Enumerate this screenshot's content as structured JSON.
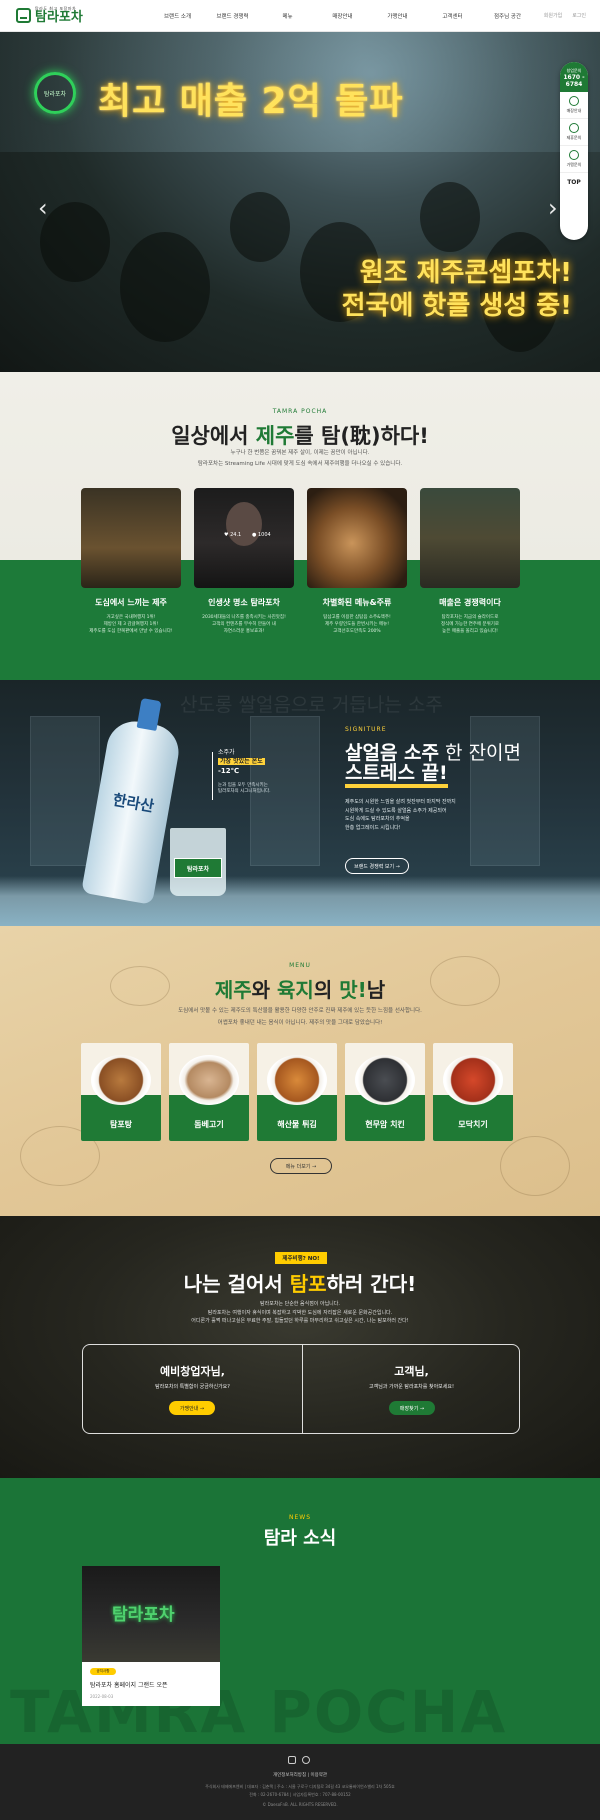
{
  "header": {
    "logo_sub": "탐라도 최고 포장마차",
    "logo_main": "탐라포차",
    "nav": [
      "브랜드 소개",
      "브랜드 경쟁력",
      "메뉴",
      "매장안내",
      "가맹안내",
      "고객센터",
      "점주님 공간"
    ],
    "util": [
      "회원가입",
      "로그인"
    ]
  },
  "hero": {
    "badge": "탐라포차",
    "line1": "최고 매출 2억 돌파",
    "line2a": "원조 제주콘셉포차!",
    "line2b": "전국에 핫플 생성 중!",
    "prev": "‹",
    "next": "›"
  },
  "quick": {
    "phone_label": "창업문의",
    "phone_a": "1670 -",
    "phone_b": "6784",
    "items": [
      "매장안내",
      "제휴문의",
      "가맹문의"
    ],
    "top": "TOP"
  },
  "intro": {
    "eyebrow": "TAMRA POCHA",
    "title_a": "일상에서 ",
    "title_g": "제주",
    "title_b": "를 탐(耽)하다!",
    "desc1": "누구나 한 번쯤은 꿈꿔본 제주 살이, 이제는 꿈만이 아닙니다.",
    "desc2": "탐라포차는 Streaming Life 시대에 맞게 도심 속에서 제주여행을 더나오실 수 있습니다.",
    "cards": [
      {
        "title": "도심에서 느끼는 제주",
        "d1": "거고싶은 국내여행지 1위!",
        "d2": "제방인 제 3 감귤여행지 1위!",
        "d3": "제주도를 도심 한복판에서 만날 수 있습니다!"
      },
      {
        "title": "인생샷 명소 탐라포차",
        "d1": "2030세대들의 나즈를 충족시키는 사진맛집!",
        "d2": "고객의 컨텐츠를 무수히 만들어 내",
        "d3": "자연스러운 홍보효과!"
      },
      {
        "title": "차별화된 메뉴&주류",
        "d1": "탐삼고를 이용한 삼탐음 소주&맥주!",
        "d2": "제주 우량인도들 한번시키는 메뉴!",
        "d3": "고객선호도만족도 200%"
      },
      {
        "title": "매출은 경쟁력이다",
        "d1": "탐라포차는 지금의 슬라이드로",
        "d2": "정식에 가능한 연주에 분위기로",
        "d3": "높은 매출을 올리고 있습니다!"
      }
    ],
    "like_count": "24.1",
    "comment_count": "1004"
  },
  "signature": {
    "bg_text": "산도롱 쌀얼음으로 거듭나는 소주",
    "temp_a": "소주가",
    "temp_hl": "가장 맛있는 온도",
    "temp_deg": "-12℃",
    "temp_s1": "눈과 입을 모두 만족시키는",
    "temp_s2": "탐라포차의 시그니처입니다.",
    "bottle_label": "한라산",
    "glass_label": "탐라포차",
    "eyebrow": "SIGNITURE",
    "t1_a": "살얼음 소주",
    "t1_b": " 한 잔이면",
    "t2": "스트레스 끝!",
    "d1": "제주도의 시원한 느낌을 살려 첫잔부터 마지막 잔까지",
    "d2": "시원하게 드실 수 있도록 살얼음 소주가 제공되어",
    "d3": "도심 속에도 탐라포차의 추억을",
    "d4": "한층 업그레이드 시킵니다!",
    "btn": "브랜드 경쟁력 보기 →"
  },
  "menu": {
    "eyebrow": "MENU",
    "title_a": "제주",
    "title_b": "와 ",
    "title_c": "육지",
    "title_d": "의 ",
    "title_e": "맛!",
    "title_f": "남",
    "desc1": "도심에서 맛볼 수 있는 제주도의 특산물을 활용한 다양한 안주로 진짜 제주에 있는 듯한 느낌을 선사합니다.",
    "desc2": "어썹포차 좋내던 내는 음식이 아닙니다. 제주의 맛을 그대로 담았습니다!",
    "items": [
      "탐포탕",
      "돔베고기",
      "해산물 튀김",
      "현무암 치킨",
      "모닥치기"
    ],
    "btn": "메뉴 더보기 →"
  },
  "startup": {
    "tag": "제주비행? NO!",
    "title_a": "나는 걸어서 ",
    "title_y": "탐포",
    "title_b": "하러 간다!",
    "d1": "탐라포차는 단순한 음식점이 아닙니다.",
    "d2": "탐라포차는 여행이자 휴식이며 복잡하고 각박한 도심에 자리잡은 새로운 문화공간입니다.",
    "d3": "어디론가 훌쩍 떠나고싶은 무료한 주말, 힘들었던 하루를 마무리하고 쉬고싶은 시간, 나는 탐포하러 간다!",
    "left_title": "예비창업자님,",
    "left_desc": "탐라포차의 특별함이 궁금하신가요?",
    "left_btn": "가맹안내 →",
    "right_title": "고객님,",
    "right_desc": "고객님과 가까운 탐라포차를 찾아보세요!",
    "right_btn": "매장찾기 →",
    "accent_yellow": "#ffcc00",
    "accent_green": "#1f7a35"
  },
  "news": {
    "eyebrow": "NEWS",
    "title": "탐라 소식",
    "watermark": "TAMRA POCHA",
    "item": {
      "logo": "탐라포차",
      "tag": "공지사항",
      "title": "탐라포차 홈페이지 그랜드 오픈",
      "date": "2022-08-03"
    }
  },
  "footer": {
    "icons": [
      "facebook-icon",
      "instagram-icon"
    ],
    "links": "개인정보처리방침 | 이용약관",
    "info1": "주식회사 태제에프엔비 | 대표자 : 김춘택 | 주소 : 서울 구로구 디지털로 34길 43 코오롱싸이언스밸리 1차 505호",
    "info2": "전화 : 02-2670-6784 | 사업자등록번호 : 707-88-00152",
    "copy": "© DaesoFnB. ALL RIGHTS RESERVED."
  }
}
